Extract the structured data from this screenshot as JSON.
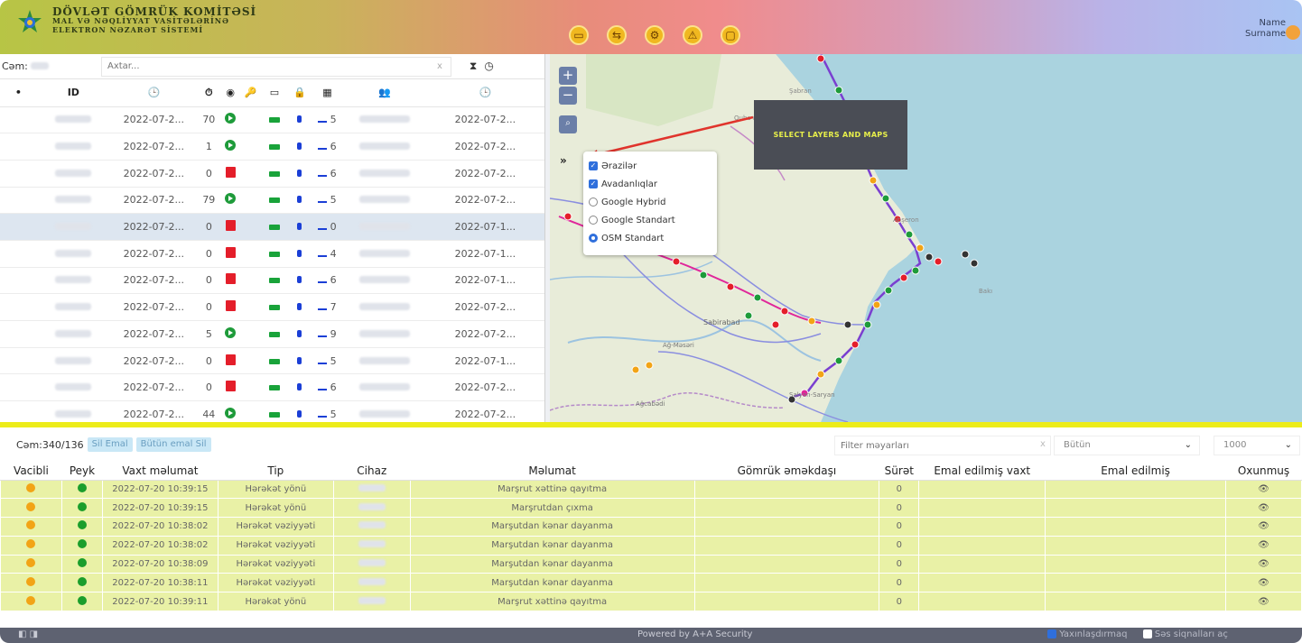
{
  "header": {
    "brand_line1": "DÖVLƏT GÖMRÜK KOMİTƏSİ",
    "brand_line2": "MAL VƏ NƏQLİYYAT VASİTƏLƏRİNƏ",
    "brand_line3": "ELEKTRON NƏZARƏT SİSTEMİ",
    "user_name": "Name",
    "user_surname": "Surname",
    "icons": [
      "monitor-icon",
      "route-icon",
      "settings-gear-icon",
      "alarm-icon",
      "window-icon"
    ]
  },
  "left_panel": {
    "cem_label": "Cəm:",
    "search_placeholder": "Axtar...",
    "search_clear": "x",
    "columns": [
      "•",
      "ID",
      "🕒",
      "⏱",
      "◉",
      "🔑",
      "▭",
      "🔒",
      "▦",
      "👥",
      "🕒"
    ],
    "rows": [
      {
        "date": "2022-07-2...",
        "speed": "70",
        "status": "green",
        "sat": "5",
        "last": "2022-07-2..."
      },
      {
        "date": "2022-07-2...",
        "speed": "1",
        "status": "green",
        "sat": "6",
        "last": "2022-07-2..."
      },
      {
        "date": "2022-07-2...",
        "speed": "0",
        "status": "red",
        "sat": "6",
        "last": "2022-07-2..."
      },
      {
        "date": "2022-07-2...",
        "speed": "79",
        "status": "green",
        "sat": "5",
        "last": "2022-07-2..."
      },
      {
        "date": "2022-07-2...",
        "speed": "0",
        "status": "red",
        "sat": "0",
        "last": "2022-07-1..."
      },
      {
        "date": "2022-07-2...",
        "speed": "0",
        "status": "red",
        "sat": "4",
        "last": "2022-07-1..."
      },
      {
        "date": "2022-07-2...",
        "speed": "0",
        "status": "red",
        "sat": "6",
        "last": "2022-07-1..."
      },
      {
        "date": "2022-07-2...",
        "speed": "0",
        "status": "red",
        "sat": "7",
        "last": "2022-07-2..."
      },
      {
        "date": "2022-07-2...",
        "speed": "5",
        "status": "green",
        "sat": "9",
        "last": "2022-07-2..."
      },
      {
        "date": "2022-07-2...",
        "speed": "0",
        "status": "red",
        "sat": "5",
        "last": "2022-07-1..."
      },
      {
        "date": "2022-07-2...",
        "speed": "0",
        "status": "red",
        "sat": "6",
        "last": "2022-07-2..."
      },
      {
        "date": "2022-07-2...",
        "speed": "44",
        "status": "green",
        "sat": "5",
        "last": "2022-07-2..."
      }
    ]
  },
  "map": {
    "zoom_in": "+",
    "zoom_out": "−",
    "expand": "»",
    "callout": "SELECT LAYERS AND MAPS",
    "layers": [
      {
        "label": "Ərazilər",
        "type": "checkbox",
        "checked": true
      },
      {
        "label": "Avadanlıqlar",
        "type": "checkbox",
        "checked": true
      },
      {
        "label": "Google Hybrid",
        "type": "radio",
        "checked": false
      },
      {
        "label": "Google Standart",
        "type": "radio",
        "checked": false
      },
      {
        "label": "OSM Standart",
        "type": "radio",
        "checked": true
      }
    ],
    "place_labels": [
      "Quba rayonu",
      "Şabran",
      "Abşeron",
      "Bakı",
      "Sabirabad",
      "Ağ-Məsəri",
      "Salyan-Saryan",
      "Ağcabədi"
    ]
  },
  "events": {
    "count": "Cəm:340/136",
    "btn_delete": "Sil Emal",
    "btn_delete_all": "Bütün emal Sil",
    "filter_placeholder": "Filter məyarları",
    "filter_clear": "x",
    "select_type": "Bütün",
    "select_limit": "1000",
    "columns": [
      "Vacibli",
      "Peyk",
      "Vaxt məlumat",
      "Tip",
      "Cihaz",
      "Məlumat",
      "Gömrük əməkdaşı",
      "Sürət",
      "Emal edilmiş vaxt",
      "Emal edilmiş",
      "Oxunmuş"
    ],
    "rows": [
      {
        "time": "2022-07-20 10:39:15",
        "type": "Hərəkət yönü",
        "info": "Marşrut xəttinə qayıtma",
        "speed": "0"
      },
      {
        "time": "2022-07-20 10:39:15",
        "type": "Hərəkət yönü",
        "info": "Marşrutdan çıxma",
        "speed": "0"
      },
      {
        "time": "2022-07-20 10:38:02",
        "type": "Hərəkət vəziyyəti",
        "info": "Marşutdan kənar dayanma",
        "speed": "0"
      },
      {
        "time": "2022-07-20 10:38:02",
        "type": "Hərəkət vəziyyəti",
        "info": "Marşutdan kənar dayanma",
        "speed": "0"
      },
      {
        "time": "2022-07-20 10:38:09",
        "type": "Hərəkət vəziyyəti",
        "info": "Marşutdan kənar dayanma",
        "speed": "0"
      },
      {
        "time": "2022-07-20 10:38:11",
        "type": "Hərəkət vəziyyəti",
        "info": "Marşutdan kənar dayanma",
        "speed": "0"
      },
      {
        "time": "2022-07-20 10:39:11",
        "type": "Hərəkət yönü",
        "info": "Marşrut xəttinə qayıtma",
        "speed": "0"
      }
    ]
  },
  "footer": {
    "powered": "Powered by A+A Security",
    "opt1": "Yaxınlaşdırmaq",
    "opt2": "Səs siqnalları aç"
  },
  "colors": {
    "accent": "#2f6fdc",
    "event_row": "#e9f1a6",
    "strip": "#ecec1a",
    "green": "#1e9b3a",
    "red": "#e41e2a"
  }
}
